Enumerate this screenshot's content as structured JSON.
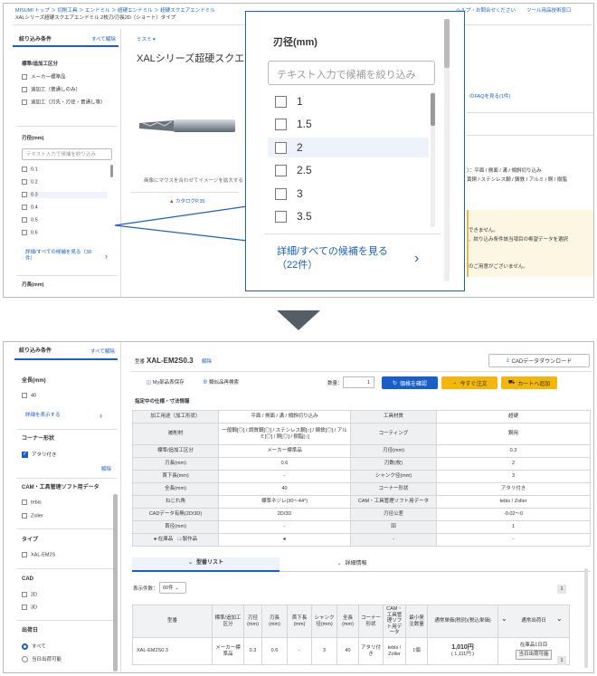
{
  "top": {
    "breadcrumb": [
      "MISUMI トップ",
      "切削工具",
      "エンドミル",
      "超硬エンドミル",
      "超硬スクエアエンドミル"
    ],
    "breadcrumb_sub": "XALシリーズ超硬スクエアエンドミル 2枚刃/刃長2D（ショート）タイプ",
    "header_links": [
      "ヘルプ・お問合せください",
      "ツール用品技術窓口"
    ],
    "filter_title": "絞り込み条件",
    "clear_all": "すべて解除",
    "section1": "標準/追加工区分",
    "section1_options": [
      "メーカー標準品",
      "追加工（普通しのみ）",
      "追加工（刃先・刃径・普通し等）"
    ],
    "section2": "刃径(mm)",
    "search_placeholder": "テキスト入力で候補を絞り込み",
    "diameter_options": [
      "0.1",
      "0.2",
      "0.3",
      "0.4",
      "0.5",
      "0.6"
    ],
    "more_link": "詳細/すべての候補を見る（38件）",
    "section3": "刃長(mm)",
    "brand": "ミスミ",
    "product_title": "XALシリーズ超硬スクエ",
    "hover_note": "画像にマウスを合わせてイメージを拡大する",
    "catalog": "カタログP.35",
    "faq": "のFAQを見る(1件)",
    "spec_line1": "）：平面 / 側面 / 溝 / 傾斜切り込み",
    "spec_line2": "黄銅 / ステンレス鋼 / 鋳鉄 / アルミ / 銅 / 樹脂",
    "notice": [
      "できません。",
      "、絞り込み条件該当項目の希望データを選択",
      "のご用意がございません。"
    ]
  },
  "zoom": {
    "title": "刃径(mm)",
    "placeholder": "テキスト入力で候補を絞り込み",
    "options": [
      "1",
      "1.5",
      "2",
      "2.5",
      "3",
      "3.5"
    ],
    "more_link": "詳細/すべての候補を見る（22件）"
  },
  "bottom": {
    "filter_title": "絞り込み条件",
    "clear_all": "すべて解除",
    "total_length": {
      "title": "全長(mm)",
      "options": [
        "40"
      ],
      "link": "詳細を表示する"
    },
    "corner": {
      "title": "コーナー形状",
      "options": [
        "アタリ付き"
      ],
      "clear": "解除"
    },
    "cam": {
      "title": "CAM・工具管理ソフト用データ",
      "options": [
        "tebis",
        "Zoller"
      ]
    },
    "type": {
      "title": "タイプ",
      "options": [
        "XAL-EM2S"
      ]
    },
    "cad": {
      "title": "CAD",
      "options": [
        "2D",
        "3D"
      ]
    },
    "ship": {
      "title": "出荷日",
      "options": [
        "すべて",
        "当日出荷可能"
      ]
    },
    "model_label": "型番",
    "model": "XAL-EM2S0.3",
    "release": "解除",
    "cad_button": "CADデータダウンロード",
    "save_button": "My部品表保存",
    "compare_button": "類似品再検索",
    "qty_label": "数量：",
    "qty": "1",
    "confirm_button": "価格を確認",
    "order_button": "今すぐ注文",
    "cart_button": "カートへ追加",
    "spec_title": "指定中の仕様・寸法情報",
    "specs": [
      [
        "加工用途（加工形状）",
        "平面 / 側面 / 溝 / 傾斜切り込み",
        "工具材質",
        "超硬"
      ],
      [
        "被削材",
        "一般鋼[◎] / 調質鋼[◎] / ステンレス鋼[○] / 鋳鉄[◎] / アルミ[◎] / 銅[◎] / 樹脂[○]",
        "コーティング",
        "鋼用"
      ],
      [
        "標準/追加工区分",
        "メーカー標準品",
        "刃径(mm)",
        "0.3"
      ],
      [
        "刃長(mm)",
        "0.6",
        "刃数(枚)",
        "2"
      ],
      [
        "首下長(mm)",
        "-",
        "シャンク径(mm)",
        "3"
      ],
      [
        "全長(mm)",
        "40",
        "コーナー形状",
        "アタリ付き"
      ],
      [
        "ねじれ角",
        "標準ネジレ(30〜44°)",
        "CAM・工具管理ソフト用データ",
        "tebis / Zoller"
      ],
      [
        "CADデータ有無(2D/3D)",
        "2D/3D",
        "刃径公差",
        "-0.02〜0"
      ],
      [
        "首径(mm)",
        "-",
        "回",
        "1"
      ],
      [
        "●:在庫品　□:製作品",
        "●",
        "-",
        "-"
      ]
    ],
    "tabs": [
      "型番リスト",
      "詳細情報"
    ],
    "per_page_label": "表示件数：",
    "per_page": "60件",
    "page": "1",
    "result_headers": [
      "型番",
      "標準/追加工区分",
      "刃径(mm)",
      "刃長(mm)",
      "首下長(mm)",
      "シャンク径(mm)",
      "全長(mm)",
      "コーナー形状",
      "CAM・工具管理ソフト用データ",
      "最小発注数量",
      "通常単価(税別)(税込単価)",
      "通常出荷日"
    ],
    "result_row": {
      "model": "XAL-EM2S0.3",
      "kubun": "メーカー標準品",
      "d": "0.3",
      "len": "0.6",
      "neck": "-",
      "shank": "3",
      "total": "40",
      "corner": "アタリ付き",
      "cam": "tebis / Zoller",
      "min": "1個",
      "price": "1,010円",
      "price_tax": "( 1,111円 )",
      "ship": "在庫品1日目",
      "ship_badge": "当日出荷可能"
    }
  },
  "colors": {
    "accent": "#1a5ec8",
    "order_yellow": "#f3b60c",
    "confirm_blue": "#1a5ec8",
    "arrow": "#555e66"
  }
}
